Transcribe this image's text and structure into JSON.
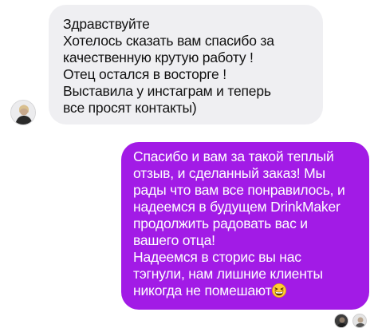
{
  "conversation": {
    "incoming_message": {
      "lines": [
        "Здравствуйте",
        "Хотелось сказать вам спасибо за",
        "качественную крутую работу !",
        "Отец остался в восторге !",
        "Выставила у инстаграм и теперь",
        "все просят контакты)"
      ]
    },
    "outgoing_message": {
      "lines": [
        "Спасибо и вам за такой теплый",
        "отзыв, и сделанный заказ! Мы",
        "рады что вам все понравилось, и",
        "надеемся в будущем DrinkMaker",
        "продолжить радовать вас и",
        "вашего отца!",
        "Надеемся в сторис вы нас",
        "тэгнули, нам лишние клиенты",
        "никогда не помешают"
      ],
      "emoji": "grinning-squinting-face"
    }
  },
  "colors": {
    "incoming_bubble": "#efeff2",
    "outgoing_bubble": "#a21be6",
    "incoming_text": "#111111",
    "outgoing_text": "#ffffff"
  }
}
